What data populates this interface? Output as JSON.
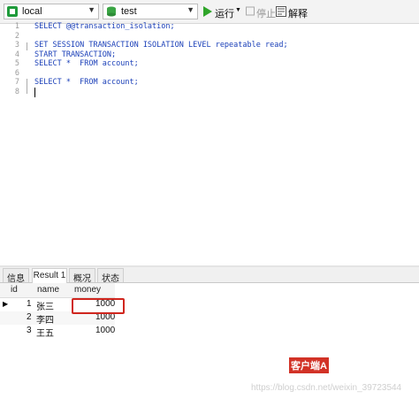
{
  "toolbar": {
    "connection": "local",
    "database": "test",
    "run_label": "运行",
    "stop_label": "停止",
    "explain_label": "解释",
    "colors": {
      "run": "#2fa52a",
      "connection_icon": "#1f9b3b",
      "database_icon": "#3aa544"
    }
  },
  "editor": {
    "line_numbers": [
      "1",
      "2",
      "3",
      "4",
      "5",
      "6",
      "7",
      "8"
    ],
    "lines": [
      "SELECT @@transaction_isolation;",
      "",
      "SET SESSION TRANSACTION ISOLATION LEVEL repeatable read;",
      "START TRANSACTION;",
      "SELECT *  FROM account;",
      "",
      "SELECT *  FROM account;",
      ""
    ]
  },
  "tabs": [
    "信息",
    "Result 1",
    "概况",
    "状态"
  ],
  "active_tab": "Result 1",
  "table": {
    "columns": [
      "id",
      "name",
      "money"
    ],
    "rows": [
      {
        "id": "1",
        "name": "张三",
        "money": "1000"
      },
      {
        "id": "2",
        "name": "李四",
        "money": "1000"
      },
      {
        "id": "3",
        "name": "王五",
        "money": "1000"
      }
    ]
  },
  "annotation": "客户端A",
  "watermark": "https://blog.csdn.net/weixin_39723544"
}
